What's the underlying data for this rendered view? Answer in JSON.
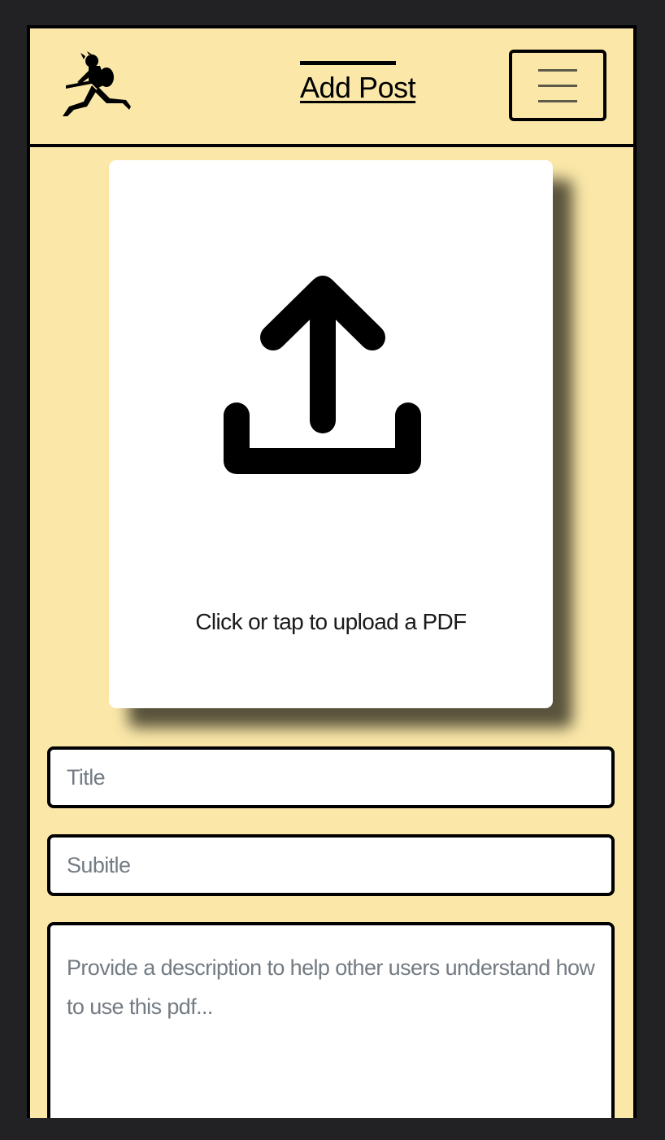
{
  "header": {
    "logo_icon": "guitarist-jumping-logo",
    "title": "Add Post",
    "menu_icon": "hamburger-menu-icon"
  },
  "upload": {
    "icon": "upload-icon",
    "label": "Click or tap to upload a PDF"
  },
  "form": {
    "title_placeholder": "Title",
    "title_value": "",
    "subtitle_placeholder": "Subitle",
    "subtitle_value": "",
    "description_placeholder": "Provide a description to help other users understand how to use this pdf...",
    "description_value": ""
  },
  "colors": {
    "background": "#fbe8a9",
    "outer": "#222224",
    "border": "#000000",
    "card": "#ffffff",
    "placeholder": "#737b83"
  }
}
